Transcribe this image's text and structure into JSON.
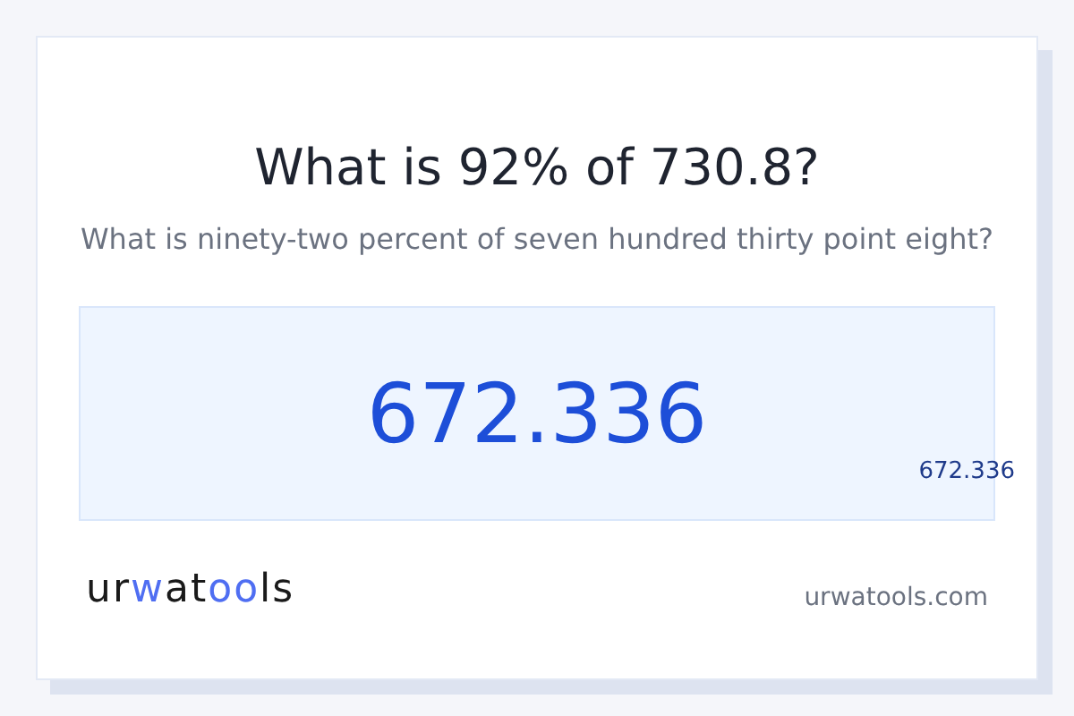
{
  "title": "What is 92% of 730.8?",
  "subtitle": "What is ninety-two percent of seven hundred thirty point eight?",
  "result": {
    "value": "672.336",
    "caption": "672.336"
  },
  "logo": [
    {
      "text": "ur",
      "accent": false
    },
    {
      "text": "w",
      "accent": true
    },
    {
      "text": "at",
      "accent": false
    },
    {
      "text": "oo",
      "accent": true
    },
    {
      "text": "ls",
      "accent": false
    }
  ],
  "site": "urwatools.com"
}
